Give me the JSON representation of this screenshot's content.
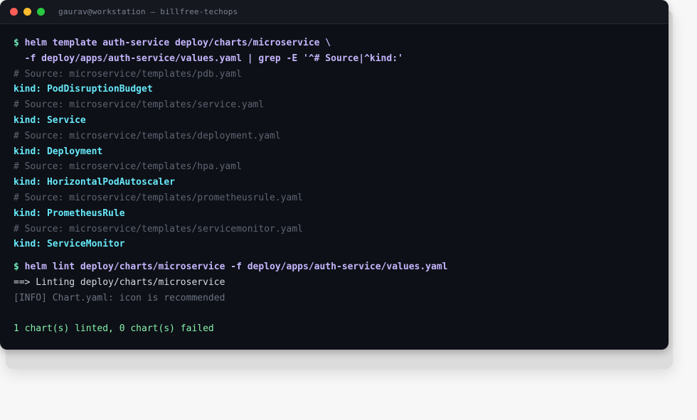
{
  "window": {
    "title": "gaurav@workstation — billfree-techops"
  },
  "terminal": {
    "prompt_symbol": "$",
    "command1_line1": "helm template auth-service deploy/charts/microservice \\",
    "command1_line2": "  -f deploy/apps/auth-service/values.yaml | grep -E '^# Source|^kind:'",
    "output1": [
      {
        "type": "comment",
        "text": "# Source: microservice/templates/pdb.yaml"
      },
      {
        "type": "kind",
        "text": "kind: PodDisruptionBudget"
      },
      {
        "type": "comment",
        "text": "# Source: microservice/templates/service.yaml"
      },
      {
        "type": "kind",
        "text": "kind: Service"
      },
      {
        "type": "comment",
        "text": "# Source: microservice/templates/deployment.yaml"
      },
      {
        "type": "kind",
        "text": "kind: Deployment"
      },
      {
        "type": "comment",
        "text": "# Source: microservice/templates/hpa.yaml"
      },
      {
        "type": "kind",
        "text": "kind: HorizontalPodAutoscaler"
      },
      {
        "type": "comment",
        "text": "# Source: microservice/templates/prometheusrule.yaml"
      },
      {
        "type": "kind",
        "text": "kind: PrometheusRule"
      },
      {
        "type": "comment",
        "text": "# Source: microservice/templates/servicemonitor.yaml"
      },
      {
        "type": "kind",
        "text": "kind: ServiceMonitor"
      }
    ],
    "command2": "helm lint deploy/charts/microservice -f deploy/apps/auth-service/values.yaml",
    "lint_output": "==> Linting deploy/charts/microservice",
    "lint_info": "[INFO] Chart.yaml: icon is recommended",
    "lint_summary": "1 chart(s) linted, 0 chart(s) failed"
  }
}
